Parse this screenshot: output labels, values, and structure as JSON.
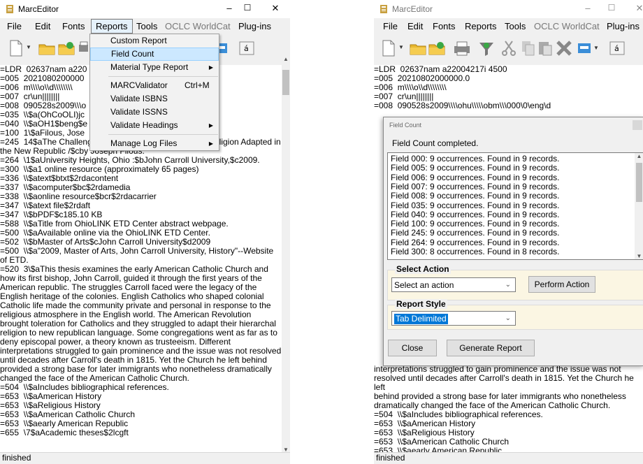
{
  "left_window": {
    "title": "MarcEditor",
    "window_controls": {
      "minimize": "–",
      "maximize": "☐",
      "close": "✕"
    },
    "menu": [
      "File",
      "Edit",
      "Fonts",
      "Reports",
      "Tools",
      "OCLC WorldCat",
      "Plug-ins"
    ],
    "reports_menu": {
      "items": [
        {
          "label": "Custom Report"
        },
        {
          "label": "Field Count",
          "highlighted": true
        },
        {
          "label": "Material Type Report",
          "submenu": true
        },
        {
          "label": "MARCValidator",
          "shortcut": "Ctrl+M"
        },
        {
          "label": "Validate ISBNS"
        },
        {
          "label": "Validate ISSNS"
        },
        {
          "label": "Validate Headings",
          "submenu": true
        },
        {
          "label": "Manage Log Files",
          "submenu": true
        }
      ]
    },
    "editor_lines": [
      "=LDR  02637nam a220",
      "=005  2021080200000",
      "=006  m\\\\\\\\o\\\\d\\\\\\\\\\\\\\\\",
      "=007  cr\\un||||||||",
      "=008  090528s2009\\\\\\o",
      "=035  \\\\$a(OhCoOLI)jc",
      "=040  \\\\$aOH1$beng$e",
      "=100  1\\$aFilous, Jose",
      "=245  14$aThe Challenge of Toleration :$bAnti-Catholic Religion Adapted in the New Republic /$cby Joseph Filous.",
      "=264  \\1$aUniversity Heights, Ohio :$bJohn Carroll University,$c2009.",
      "=300  \\\\$a1 online resource (approximately 65 pages)",
      "=336  \\\\$atext$btxt$2rdacontent",
      "=337  \\\\$acomputer$bc$2rdamedia",
      "=338  \\\\$aonline resource$bcr$2rdacarrier",
      "=347  \\\\$atext file$2rdaft",
      "=347  \\\\$bPDF$c185.10 KB",
      "=588  \\\\$aTitle from OhioLINK ETD Center abstract webpage.",
      "=500  \\\\$aAvailable online via the OhioLINK ETD Center.",
      "=502  \\\\$bMaster of Arts$cJohn Carroll University$d2009",
      "=500  \\\\$a\"2009, Master of Arts, John Carroll University, History\"--Website of ETD.",
      "=520  3\\$aThis thesis examines the early American Catholic Church and how its first bishop, John Carroll, guided it through the first years of the American republic. The struggles Carroll faced were the legacy of the English heritage of the colonies. English Catholics who shaped colonial Catholic life made the community private and personal in response to the religious atmosphere in the English world. The American Revolution brought toleration for Catholics and they struggled to adapt their hierarchal religion to new republican language. Some congregations went as far as to deny episcopal power, a theory known as trusteeism. Different interpretations struggled to gain prominence and the issue was not resolved until decades after Carroll's death in 1815. Yet the Church he left behind provided a strong base for later immigrants who nonetheless dramatically changed the face of the American Catholic Church.",
      "=504  \\\\$aIncludes bibliographical references.",
      "=653  \\\\$aAmerican History",
      "=653  \\\\$aReligious History",
      "=653  \\\\$aAmerican Catholic Church",
      "=653  \\\\$aearly American Republic",
      "=655  \\7$aAcademic theses$2lcgft"
    ],
    "status": "finished"
  },
  "right_window": {
    "title": "MarcEditor",
    "window_controls": {
      "minimize": "–",
      "maximize": "☐",
      "close": "✕"
    },
    "menu": [
      "File",
      "Edit",
      "Fonts",
      "Reports",
      "Tools",
      "OCLC WorldCat",
      "Plug-ins"
    ],
    "editor_top_lines": [
      "=LDR  02637nam a22004217i 4500",
      "=005  20210802000000.0",
      "=006  m\\\\\\\\o\\\\d\\\\\\\\\\\\\\\\",
      "=007  cr\\un||||||||",
      "=008  090528s2009\\\\\\\\ohu\\\\\\\\\\obm\\\\\\000\\0\\eng\\d"
    ],
    "editor_bottom_lines": [
      "interpretations struggled to gain prominence and the issue was not",
      "resolved until decades after Carroll's death in 1815. Yet the Church he left",
      "behind provided a strong base for later immigrants who nonetheless",
      "dramatically changed the face of the American Catholic Church.",
      "=504  \\\\$aIncludes bibliographical references.",
      "=653  \\\\$aAmerican History",
      "=653  \\\\$aReligious History",
      "=653  \\\\$aAmerican Catholic Church",
      "=653  \\\\$aearly American Republic",
      "=655  \\7$aAcademic theses$2lcgft"
    ],
    "status": "finished"
  },
  "dialog": {
    "title": "Field Count",
    "message": "Field Count completed.",
    "results": [
      "Field 000: 9 occurrences.  Found in 9 records.",
      "Field 005: 9 occurrences.  Found in 9 records.",
      "Field 006: 9 occurrences.  Found in 9 records.",
      "Field 007: 9 occurrences.  Found in 9 records.",
      "Field 008: 9 occurrences.  Found in 9 records.",
      "Field 035: 9 occurrences.  Found in 9 records.",
      "Field 040: 9 occurrences.  Found in 9 records.",
      "Field 100: 9 occurrences.  Found in 9 records.",
      "Field 245: 9 occurrences.  Found in 9 records.",
      "Field 264: 9 occurrences.  Found in 9 records.",
      "Field 300: 8 occurrences.  Found in 8 records."
    ],
    "select_action_label": "Select Action",
    "select_action_value": "Select an action",
    "perform_action_label": "Perform Action",
    "report_style_label": "Report Style",
    "report_style_value": "Tab Delimited",
    "close_label": "Close",
    "generate_label": "Generate Report"
  }
}
